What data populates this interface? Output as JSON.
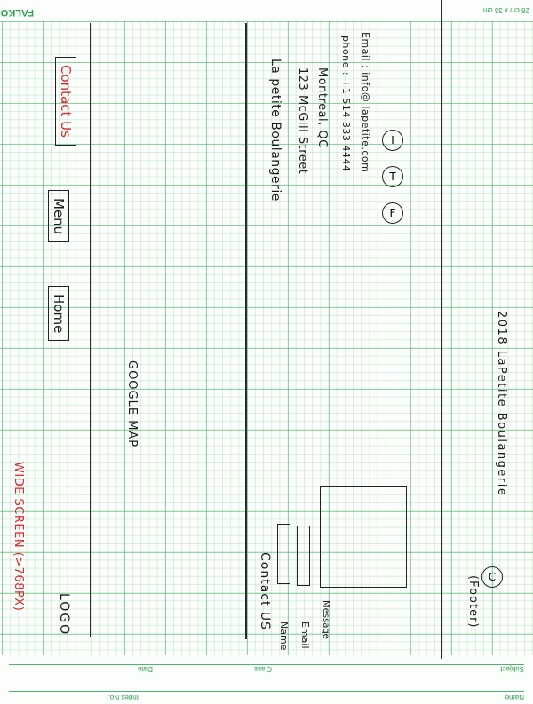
{
  "paper": {
    "brand": "FALKON",
    "size_note": "28 cm x 33 cm",
    "label_date": "Date",
    "label_class": "Class",
    "label_subject": "Subject",
    "label_index": "Index No.",
    "label_name": "Name"
  },
  "sketch": {
    "screen_note": "WIDE SCREEN (>768PX)",
    "logo": "LOGO",
    "nav": {
      "home": "Home",
      "menu": "Menu",
      "contact": "Contact Us"
    },
    "map": "GOOGLE MAP",
    "contact": {
      "title": "Contact US",
      "name": "Name",
      "email": "Email",
      "message": "Message"
    },
    "address": {
      "line1": "La petite Boulangerie",
      "line2": "123 McGill Street",
      "line3": "Montreal, QC",
      "phone": "phone : +1 514 333 4444",
      "email": "Email : info@ lapetite.com"
    },
    "social": [
      "F",
      "T",
      "I"
    ],
    "footer_label": "(Footer)",
    "copyright_symbol": "C",
    "copyright_text": "2018  LaPetite  Boulangerie"
  }
}
